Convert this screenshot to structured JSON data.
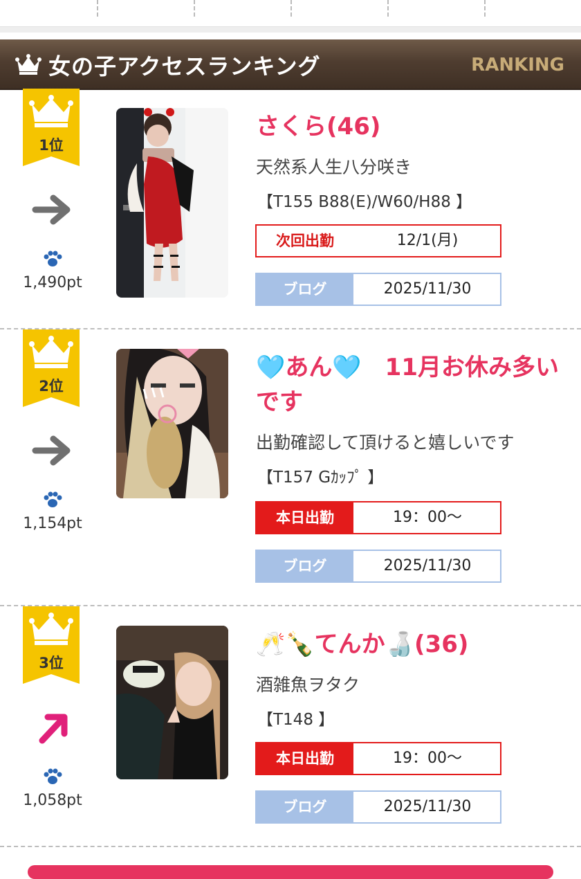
{
  "header": {
    "title": "女の子アクセスランキング",
    "english": "RANKING"
  },
  "entries": [
    {
      "rank": "1位",
      "trend": "same",
      "points": "1,490pt",
      "name": "さくら(46)",
      "catchphrase": "天然系人生八分咲き",
      "spec": "【T155 B88(E)/W60/H88 】",
      "shift_label": "次回出勤",
      "shift_value": "12/1(月)",
      "shift_type": "next",
      "blog_label": "ブログ",
      "blog_date": "2025/11/30"
    },
    {
      "rank": "2位",
      "trend": "same",
      "points": "1,154pt",
      "name": "🩵あん🩵　11月お休み多いです",
      "catchphrase": "出勤確認して頂けると嬉しいです",
      "spec": "【T157 Gｶｯﾌﾟ 】",
      "shift_label": "本日出勤",
      "shift_value": "19：00〜",
      "shift_type": "today",
      "blog_label": "ブログ",
      "blog_date": "2025/11/30"
    },
    {
      "rank": "3位",
      "trend": "up",
      "points": "1,058pt",
      "name": "🥂🍾てんか🍶(36)",
      "catchphrase": "酒雑魚ヲタク",
      "spec": "【T148 】",
      "shift_label": "本日出勤",
      "shift_value": "19：00〜",
      "shift_type": "today",
      "blog_label": "ブログ",
      "blog_date": "2025/11/30"
    }
  ],
  "colors": {
    "accent_pink": "#e6335f",
    "badge_yellow": "#f5c400",
    "shift_red": "#e31b1b",
    "blog_blue": "#a7c1e6",
    "header_brown": "#4f3d30"
  }
}
